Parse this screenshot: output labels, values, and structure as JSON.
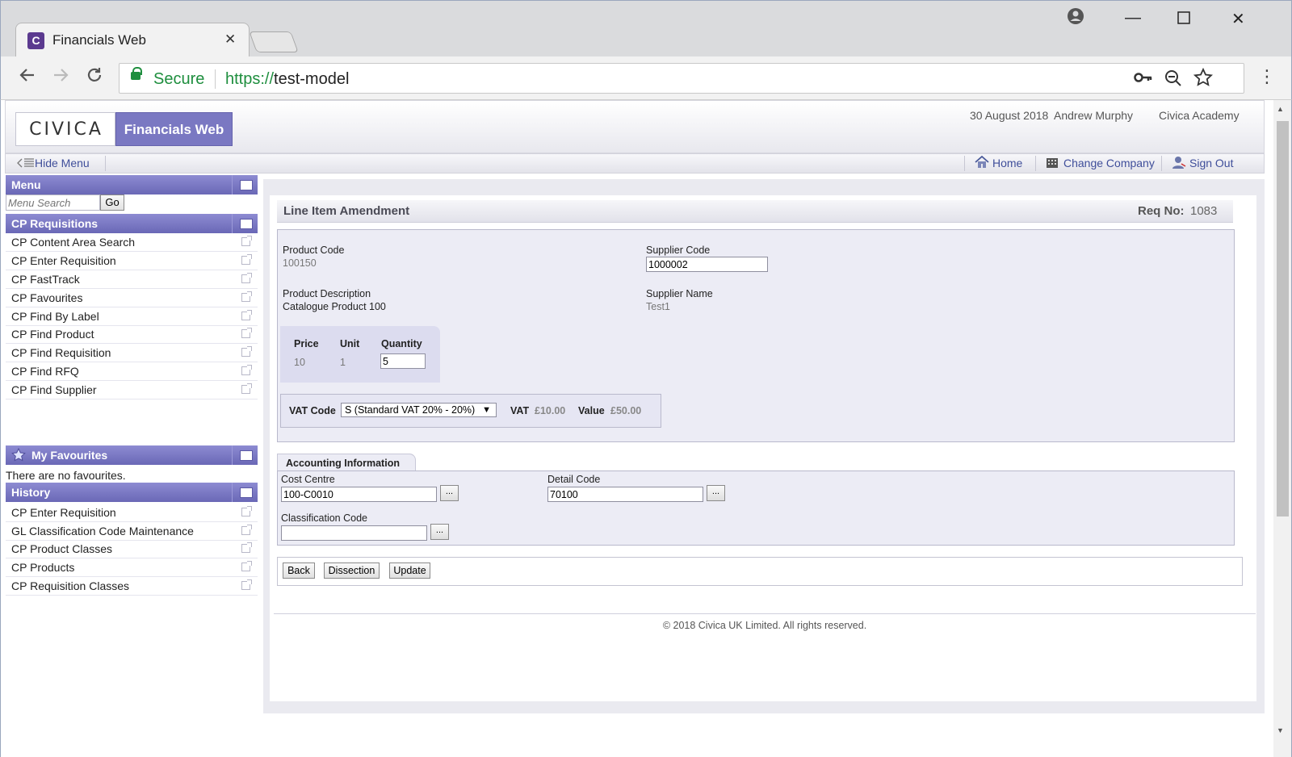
{
  "browser": {
    "tab_title": "Financials Web",
    "favicon_letter": "C",
    "secure_label": "Secure",
    "url_scheme": "https://",
    "url_host": "test-model"
  },
  "header": {
    "logo": "CIVICA",
    "app_name": "Financials Web",
    "date": "30 August 2018",
    "user": "Andrew Murphy",
    "company": "Civica Academy"
  },
  "menubar": {
    "hide_menu": "Hide Menu",
    "home": "Home",
    "change_company": "Change Company",
    "sign_out": "Sign Out"
  },
  "sidebar": {
    "menu_title": "Menu",
    "search_placeholder": "Menu Search",
    "go_label": "Go",
    "requisitions_title": "CP Requisitions",
    "requisitions": [
      "CP Content Area Search",
      "CP Enter Requisition",
      "CP FastTrack",
      "CP Favourites",
      "CP Find By Label",
      "CP Find Product",
      "CP Find Requisition",
      "CP Find RFQ",
      "CP Find Supplier"
    ],
    "favourites_title": "My Favourites",
    "no_favourites": "There are no favourites.",
    "history_title": "History",
    "history": [
      "CP Enter Requisition",
      "GL Classification Code Maintenance",
      "CP Product Classes",
      "CP Products",
      "CP Requisition Classes"
    ]
  },
  "form": {
    "title": "Line Item Amendment",
    "req_no_label": "Req No:",
    "req_no": "1083",
    "product_code_label": "Product Code",
    "product_code": "100150",
    "supplier_code_label": "Supplier Code",
    "supplier_code": "1000002",
    "product_description_label": "Product Description",
    "product_description": "Catalogue Product 100",
    "supplier_name_label": "Supplier Name",
    "supplier_name": "Test1",
    "price_label": "Price",
    "price": "10",
    "unit_label": "Unit",
    "unit": "1",
    "quantity_label": "Quantity",
    "quantity": "5",
    "vat_code_label": "VAT Code",
    "vat_code": "S (Standard VAT 20% - 20%)",
    "vat_label": "VAT",
    "vat": "£10.00",
    "value_label": "Value",
    "value": "£50.00",
    "accounting_title": "Accounting Information",
    "cost_centre_label": "Cost Centre",
    "cost_centre": "100-C0010",
    "detail_code_label": "Detail Code",
    "detail_code": "70100",
    "classification_code_label": "Classification Code",
    "classification_code": "",
    "ellipsis": "...",
    "back": "Back",
    "dissection": "Dissection",
    "update": "Update"
  },
  "footer": "© 2018 Civica UK Limited. All rights reserved."
}
